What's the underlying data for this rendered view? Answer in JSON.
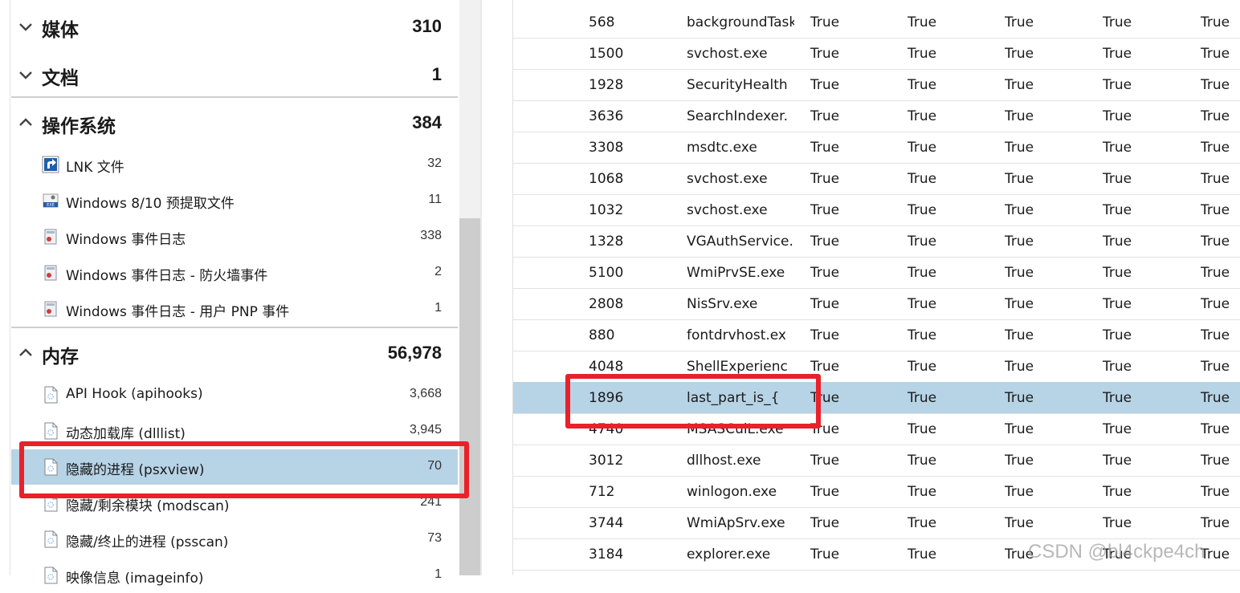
{
  "tree": {
    "groups": [
      {
        "title": "媒体",
        "count": "310",
        "expanded": false
      },
      {
        "title": "文档",
        "count": "1",
        "expanded": false
      },
      {
        "title": "操作系统",
        "count": "384",
        "expanded": true
      },
      {
        "title": "内存",
        "count": "56,978",
        "expanded": true
      }
    ],
    "os_items": [
      {
        "label": "LNK 文件",
        "count": "32",
        "icon": "shortcut-icon"
      },
      {
        "label": "Windows 8/10 预提取文件",
        "count": "11",
        "icon": "exe-icon"
      },
      {
        "label": "Windows 事件日志",
        "count": "338",
        "icon": "event-log-icon"
      },
      {
        "label": "Windows 事件日志 - 防火墙事件",
        "count": "2",
        "icon": "event-log-icon"
      },
      {
        "label": "Windows 事件日志 - 用户 PNP 事件",
        "count": "1",
        "icon": "event-log-icon"
      }
    ],
    "memory_items": [
      {
        "label": "API Hook (apihooks)",
        "count": "3,668",
        "icon": "document-icon"
      },
      {
        "label": "动态加载库 (dlllist)",
        "count": "3,945",
        "icon": "document-icon"
      },
      {
        "label": "隐藏的进程 (psxview)",
        "count": "70",
        "icon": "document-icon",
        "selected": true
      },
      {
        "label": "隐藏/剩余模块 (modscan)",
        "count": "241",
        "icon": "document-icon"
      },
      {
        "label": "隐藏/终止的进程 (psscan)",
        "count": "73",
        "icon": "document-icon"
      },
      {
        "label": "映像信息 (imageinfo)",
        "count": "1",
        "icon": "document-icon"
      }
    ]
  },
  "table": {
    "rows": [
      [
        "568",
        "backgroundTask",
        "True",
        "True",
        "True",
        "True",
        "True"
      ],
      [
        "1500",
        "svchost.exe",
        "True",
        "True",
        "True",
        "True",
        "True"
      ],
      [
        "1928",
        "SecurityHealth",
        "True",
        "True",
        "True",
        "True",
        "True"
      ],
      [
        "3636",
        "SearchIndexer.",
        "True",
        "True",
        "True",
        "True",
        "True"
      ],
      [
        "3308",
        "msdtc.exe",
        "True",
        "True",
        "True",
        "True",
        "True"
      ],
      [
        "1068",
        "svchost.exe",
        "True",
        "True",
        "True",
        "True",
        "True"
      ],
      [
        "1032",
        "svchost.exe",
        "True",
        "True",
        "True",
        "True",
        "True"
      ],
      [
        "1328",
        "VGAuthService.",
        "True",
        "True",
        "True",
        "True",
        "True"
      ],
      [
        "5100",
        "WmiPrvSE.exe",
        "True",
        "True",
        "True",
        "True",
        "True"
      ],
      [
        "2808",
        "NisSrv.exe",
        "True",
        "True",
        "True",
        "True",
        "True"
      ],
      [
        "880",
        "fontdrvhost.ex",
        "True",
        "True",
        "True",
        "True",
        "True"
      ],
      [
        "4048",
        "ShellExperienc",
        "True",
        "True",
        "True",
        "True",
        "True"
      ],
      [
        "1896",
        "last_part_is_{",
        "True",
        "True",
        "True",
        "True",
        "True"
      ],
      [
        "4740",
        "MSASCuiL.exe",
        "True",
        "True",
        "True",
        "True",
        "True"
      ],
      [
        "3012",
        "dllhost.exe",
        "True",
        "True",
        "True",
        "True",
        "True"
      ],
      [
        "712",
        "winlogon.exe",
        "True",
        "True",
        "True",
        "True",
        "True"
      ],
      [
        "3744",
        "WmiApSrv.exe",
        "True",
        "True",
        "True",
        "True",
        "True"
      ],
      [
        "3184",
        "explorer.exe",
        "True",
        "True",
        "True",
        "True",
        "True"
      ]
    ],
    "selected_row": 12
  },
  "watermark": "CSDN @bl4ckpe4ch",
  "colors": {
    "selection": "#b7d3e6",
    "highlight_box": "#e8212b"
  }
}
